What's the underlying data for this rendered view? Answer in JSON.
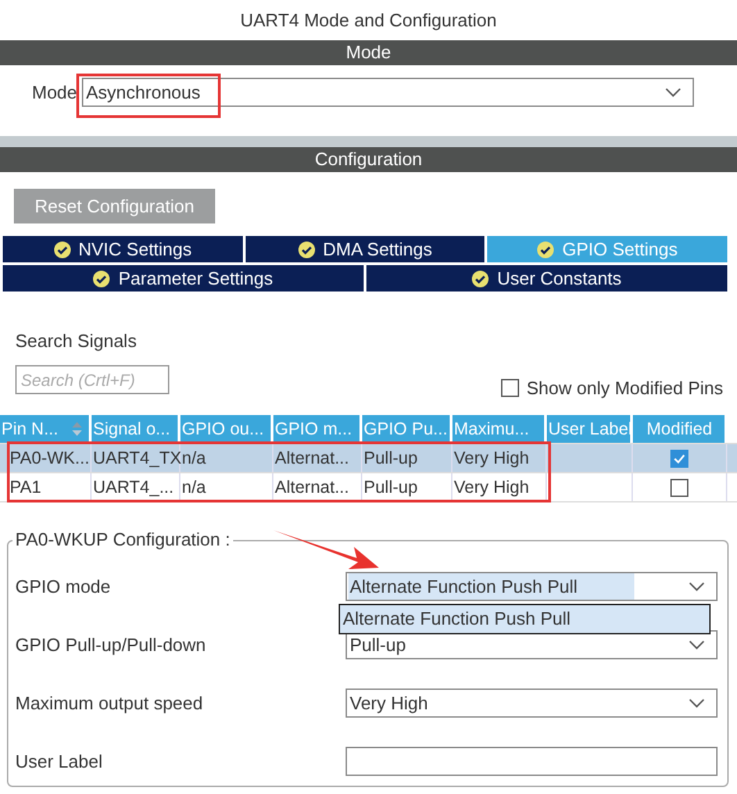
{
  "window": {
    "title": "UART4 Mode and Configuration"
  },
  "mode_section": {
    "header": "Mode",
    "label": "Mode",
    "value": "Asynchronous"
  },
  "configuration_section": {
    "header": "Configuration",
    "reset_button": "Reset Configuration",
    "tab_rows": [
      {
        "tabs": [
          {
            "label": "NVIC Settings",
            "selected": false
          },
          {
            "label": "DMA Settings",
            "selected": false
          },
          {
            "label": "GPIO Settings",
            "selected": true
          }
        ]
      },
      {
        "tabs": [
          {
            "label": "Parameter Settings",
            "selected": false
          },
          {
            "label": "User Constants",
            "selected": false
          }
        ]
      }
    ],
    "search": {
      "label": "Search Signals",
      "placeholder": "Search (Crtl+F)"
    },
    "show_only_modified": {
      "label": "Show only Modified Pins",
      "checked": false
    },
    "table": {
      "columns": [
        "Pin N...",
        "Signal o...",
        "GPIO ou...",
        "GPIO m...",
        "GPIO Pu...",
        "Maximu...",
        "User Label",
        "Modified"
      ],
      "rows": [
        {
          "cells": [
            "PA0-WK...",
            "UART4_TX",
            "n/a",
            "Alternat...",
            "Pull-up",
            "Very High",
            ""
          ],
          "selected": true,
          "modified": true
        },
        {
          "cells": [
            "PA1",
            "UART4_...",
            "n/a",
            "Alternat...",
            "Pull-up",
            "Very High",
            ""
          ],
          "selected": false,
          "modified": false
        }
      ]
    },
    "pin_config": {
      "title": "PA0-WKUP Configuration :",
      "fields": [
        {
          "label": "GPIO mode",
          "kind": "select",
          "value": "Alternate Function Push Pull",
          "focused": true
        },
        {
          "label": "GPIO Pull-up/Pull-down",
          "kind": "select",
          "value": "Pull-up",
          "focused": false
        },
        {
          "label": "Maximum output speed",
          "kind": "select",
          "value": "Very High",
          "focused": false
        },
        {
          "label": "User Label",
          "kind": "text",
          "focused": false
        }
      ],
      "dropdown": {
        "options": [
          {
            "label": "Alternate Function Push Pull",
            "selected": true
          }
        ]
      }
    }
  }
}
